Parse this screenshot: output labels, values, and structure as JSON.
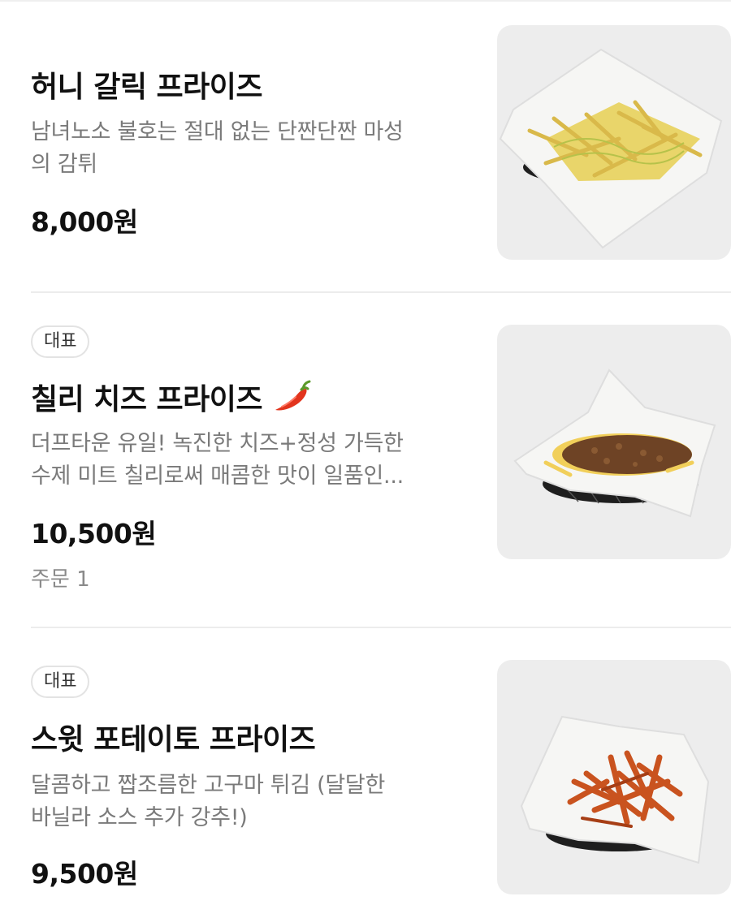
{
  "menu": {
    "items": [
      {
        "badge": "",
        "title": "허니 갈릭 프라이즈",
        "desc_line1": "남녀노소 불호는 절대 없는 단짠단짠 마성",
        "desc_line2": "의 감튀",
        "price": "8,000원",
        "orders": "",
        "image_icon": "honey-garlic-fries-image"
      },
      {
        "badge": "대표",
        "title": "칠리 치즈 프라이즈",
        "title_icon": "chili-pepper-icon",
        "desc_line1": "더프타운 유일! 녹진한 치즈+정성 가득한",
        "desc_line2": "수제 미트 칠리로써 매콤한 맛이 일품인...",
        "price": "10,500원",
        "orders": "주문 1",
        "image_icon": "chili-cheese-fries-image"
      },
      {
        "badge": "대표",
        "title": "스윗 포테이토 프라이즈",
        "desc_line1": "달콤하고 짭조름한 고구마 튀김 (달달한",
        "desc_line2": "바닐라 소스 추가 강추!)",
        "price": "9,500원",
        "orders": "",
        "image_icon": "sweet-potato-fries-image"
      }
    ]
  },
  "colors": {
    "thumb_bg": "#ededed",
    "divider": "#ececec",
    "chili_red": "#e2341d"
  }
}
